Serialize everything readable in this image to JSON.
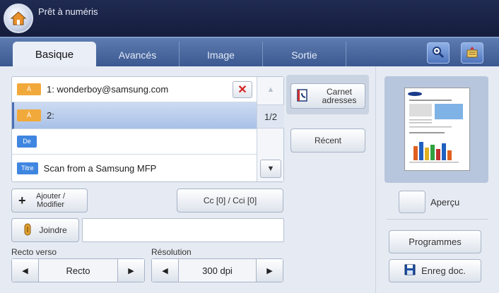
{
  "window": {
    "title": "Prêt à numéris"
  },
  "tabs": [
    {
      "label": "Basique",
      "active": true
    },
    {
      "label": "Avancés",
      "active": false
    },
    {
      "label": "Image",
      "active": false
    },
    {
      "label": "Sortie",
      "active": false
    }
  ],
  "toolbar_icons": [
    "zoom-in-icon",
    "job-status-icon"
  ],
  "recipients": {
    "rows": [
      {
        "tag": "À",
        "text": "1: wonderboy@samsung.com"
      },
      {
        "tag": "À",
        "text": "2:"
      },
      {
        "tag": "De",
        "text": ""
      },
      {
        "tag": "Titre",
        "text": "Scan from a Samsung MFP"
      }
    ],
    "page_indicator": "1/2"
  },
  "buttons": {
    "address_book": "Carnet adresses",
    "recent": "Récent",
    "add_modify": "Ajouter / Modifier",
    "cc_bcc": "Cc [0] / Cci [0]",
    "attach": "Joindre",
    "preview": "Aperçu",
    "programs": "Programmes",
    "save_doc": "Enreg doc."
  },
  "duplex": {
    "label": "Recto verso",
    "value": "Recto"
  },
  "resolution": {
    "label": "Résolution",
    "value": "300 dpi"
  },
  "colors": {
    "title_bg": "#1a2446",
    "tab_bg": "#4a68a3",
    "tag_orange": "#f2a93b",
    "tag_blue": "#3f86e0",
    "delete_red": "#d62020"
  }
}
